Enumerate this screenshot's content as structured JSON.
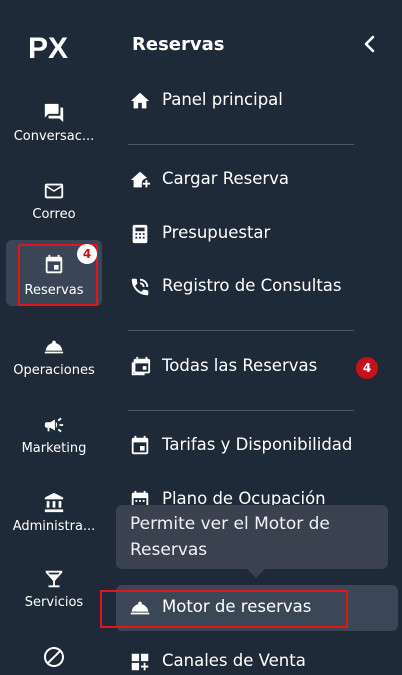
{
  "app": {
    "logo_text": "PX"
  },
  "rail": {
    "items": [
      {
        "label": "Conversac..."
      },
      {
        "label": "Correo"
      },
      {
        "label": "Reservas",
        "badge": "4"
      },
      {
        "label": "Operaciones"
      },
      {
        "label": "Marketing"
      },
      {
        "label": "Administra..."
      },
      {
        "label": "Servicios"
      }
    ]
  },
  "panel": {
    "title": "Reservas",
    "items": [
      {
        "label": "Panel principal"
      },
      {
        "label": "Cargar Reserva"
      },
      {
        "label": "Presupuestar"
      },
      {
        "label": "Registro de Consultas"
      },
      {
        "label": "Todas las Reservas",
        "badge": "4"
      },
      {
        "label": "Tarifas y Disponibilidad"
      },
      {
        "label": "Plano de Ocupación"
      },
      {
        "label": "Motor de reservas"
      },
      {
        "label": "Canales de Venta"
      }
    ]
  },
  "tooltip": {
    "text": "Permite ver el Motor de Reservas"
  },
  "colors": {
    "background": "#1f2a38",
    "badge_red": "#c4121a",
    "highlight_red": "#e3141b",
    "hover": "#3b4656"
  }
}
